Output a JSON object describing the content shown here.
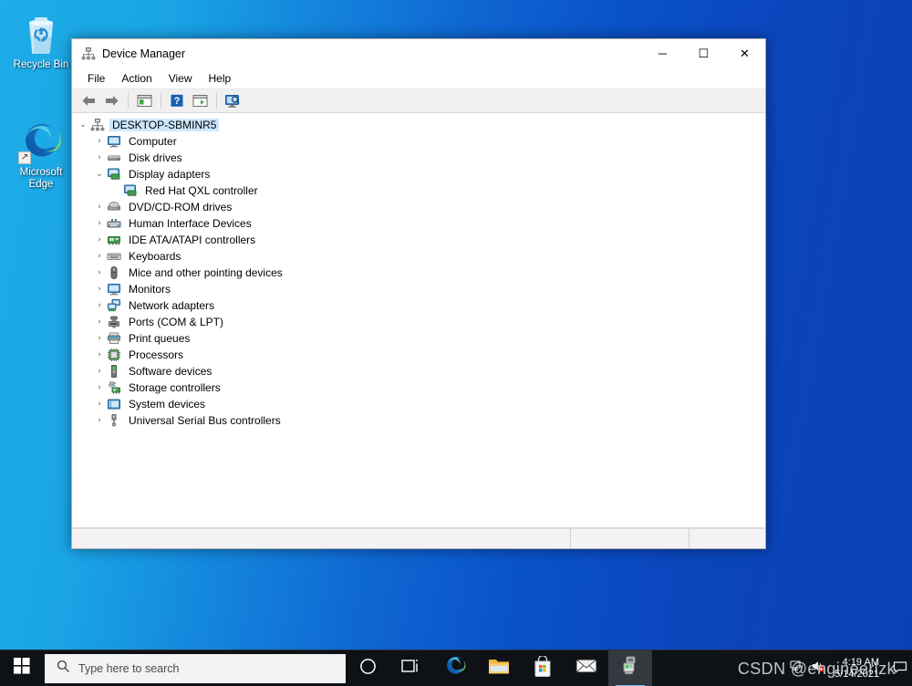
{
  "desktop": {
    "icons": [
      {
        "label": "Recycle Bin",
        "icon": "recycle-bin-icon",
        "shortcut": false
      },
      {
        "label": "Microsoft Edge",
        "icon": "microsoft-edge-icon",
        "shortcut": true
      }
    ]
  },
  "window": {
    "title": "Device Manager",
    "icon": "device-manager-icon",
    "controls": {
      "minimize": "─",
      "maximize": "☐",
      "close": "✕"
    },
    "menu": [
      {
        "label": "File",
        "name": "menu-file"
      },
      {
        "label": "Action",
        "name": "menu-action"
      },
      {
        "label": "View",
        "name": "menu-view"
      },
      {
        "label": "Help",
        "name": "menu-help"
      }
    ],
    "toolbar": [
      {
        "name": "back-icon",
        "type": "arrow-left"
      },
      {
        "name": "forward-icon",
        "type": "arrow-right"
      },
      {
        "name": "separator-1",
        "type": "separator"
      },
      {
        "name": "properties-icon",
        "type": "window-green"
      },
      {
        "name": "separator-2",
        "type": "separator"
      },
      {
        "name": "help-icon",
        "type": "question"
      },
      {
        "name": "update-driver-icon",
        "type": "window-play"
      },
      {
        "name": "separator-3",
        "type": "separator"
      },
      {
        "name": "scan-hardware-changes-icon",
        "type": "monitor-scan"
      }
    ],
    "status": {
      "pane1": "",
      "pane2": "",
      "pane3": ""
    }
  },
  "tree": {
    "root": {
      "label": "DESKTOP-SBMINR5",
      "icon": "computer-tree-icon",
      "expanded": true,
      "selected": true
    },
    "nodes": [
      {
        "label": "Computer",
        "icon": "computer-icon",
        "expanded": false,
        "depth": 1
      },
      {
        "label": "Disk drives",
        "icon": "disk-drive-icon",
        "expanded": false,
        "depth": 1
      },
      {
        "label": "Display adapters",
        "icon": "display-adapter-icon",
        "expanded": true,
        "depth": 1
      },
      {
        "label": "Red Hat QXL controller",
        "icon": "display-adapter-icon",
        "expanded": null,
        "depth": 2
      },
      {
        "label": "DVD/CD-ROM drives",
        "icon": "dvd-drive-icon",
        "expanded": false,
        "depth": 1
      },
      {
        "label": "Human Interface Devices",
        "icon": "hid-icon",
        "expanded": false,
        "depth": 1
      },
      {
        "label": "IDE ATA/ATAPI controllers",
        "icon": "ide-controller-icon",
        "expanded": false,
        "depth": 1
      },
      {
        "label": "Keyboards",
        "icon": "keyboard-icon",
        "expanded": false,
        "depth": 1
      },
      {
        "label": "Mice and other pointing devices",
        "icon": "mouse-icon",
        "expanded": false,
        "depth": 1
      },
      {
        "label": "Monitors",
        "icon": "monitor-icon",
        "expanded": false,
        "depth": 1
      },
      {
        "label": "Network adapters",
        "icon": "network-adapter-icon",
        "expanded": false,
        "depth": 1
      },
      {
        "label": "Ports (COM & LPT)",
        "icon": "port-icon",
        "expanded": false,
        "depth": 1
      },
      {
        "label": "Print queues",
        "icon": "printer-icon",
        "expanded": false,
        "depth": 1
      },
      {
        "label": "Processors",
        "icon": "processor-icon",
        "expanded": false,
        "depth": 1
      },
      {
        "label": "Software devices",
        "icon": "software-device-icon",
        "expanded": false,
        "depth": 1
      },
      {
        "label": "Storage controllers",
        "icon": "storage-controller-icon",
        "expanded": false,
        "depth": 1
      },
      {
        "label": "System devices",
        "icon": "system-device-icon",
        "expanded": false,
        "depth": 1
      },
      {
        "label": "Universal Serial Bus controllers",
        "icon": "usb-controller-icon",
        "expanded": false,
        "depth": 1
      }
    ],
    "chevron_collapsed": "›",
    "chevron_expanded": "⌄"
  },
  "taskbar": {
    "start": "start-icon",
    "search": {
      "placeholder": "Type here to search",
      "icon": "search-icon"
    },
    "buttons": [
      {
        "name": "cortana-icon",
        "type": "cortana"
      },
      {
        "name": "task-view-icon",
        "type": "taskview"
      },
      {
        "name": "microsoft-edge-taskbar-icon",
        "type": "edge"
      },
      {
        "name": "file-explorer-icon",
        "type": "explorer"
      },
      {
        "name": "microsoft-store-icon",
        "type": "store"
      },
      {
        "name": "mail-icon",
        "type": "mail"
      },
      {
        "name": "device-manager-taskbar-icon",
        "type": "devmgr",
        "active": true
      }
    ],
    "tray": [
      {
        "name": "network-icon"
      },
      {
        "name": "volume-icon"
      },
      {
        "name": "action-center-icon"
      }
    ],
    "clock": {
      "time": "4:19 AM",
      "date": "5/14/2021"
    }
  },
  "watermark": {
    "text": "CSDN @engineerlzk"
  },
  "colors": {
    "accent": "#0078d7",
    "selection": "#cce8ff",
    "taskbar": "#0e1216",
    "desktop_left": "#1eade8",
    "desktop_right": "#0c3fb4"
  }
}
